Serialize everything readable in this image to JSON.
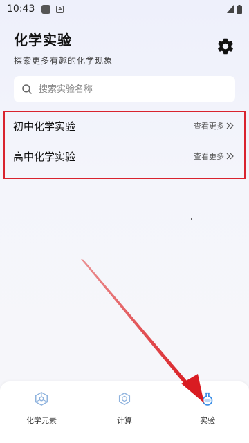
{
  "status_bar": {
    "time": "10:43",
    "icon_a": "app-notification-icon",
    "icon_b_letter": "A",
    "signal_icon": "signal-icon",
    "battery_icon": "battery-icon"
  },
  "header": {
    "title": "化学实验",
    "subtitle": "探索更多有趣的化学现象"
  },
  "settings": {
    "icon": "gear-icon"
  },
  "search": {
    "placeholder": "搜索实验名称"
  },
  "list": [
    {
      "label": "初中化学实验",
      "more": "查看更多"
    },
    {
      "label": "高中化学实验",
      "more": "查看更多"
    }
  ],
  "bottom_nav": [
    {
      "label": "化学元素",
      "icon": "atom-icon",
      "active": false
    },
    {
      "label": "计算",
      "icon": "molecule-icon",
      "active": false
    },
    {
      "label": "实验",
      "icon": "flask-icon",
      "active": true
    }
  ],
  "colors": {
    "highlight_red": "#d9232e",
    "accent_blue": "#3a8ee6",
    "inactive_icon": "#8fb3de"
  }
}
